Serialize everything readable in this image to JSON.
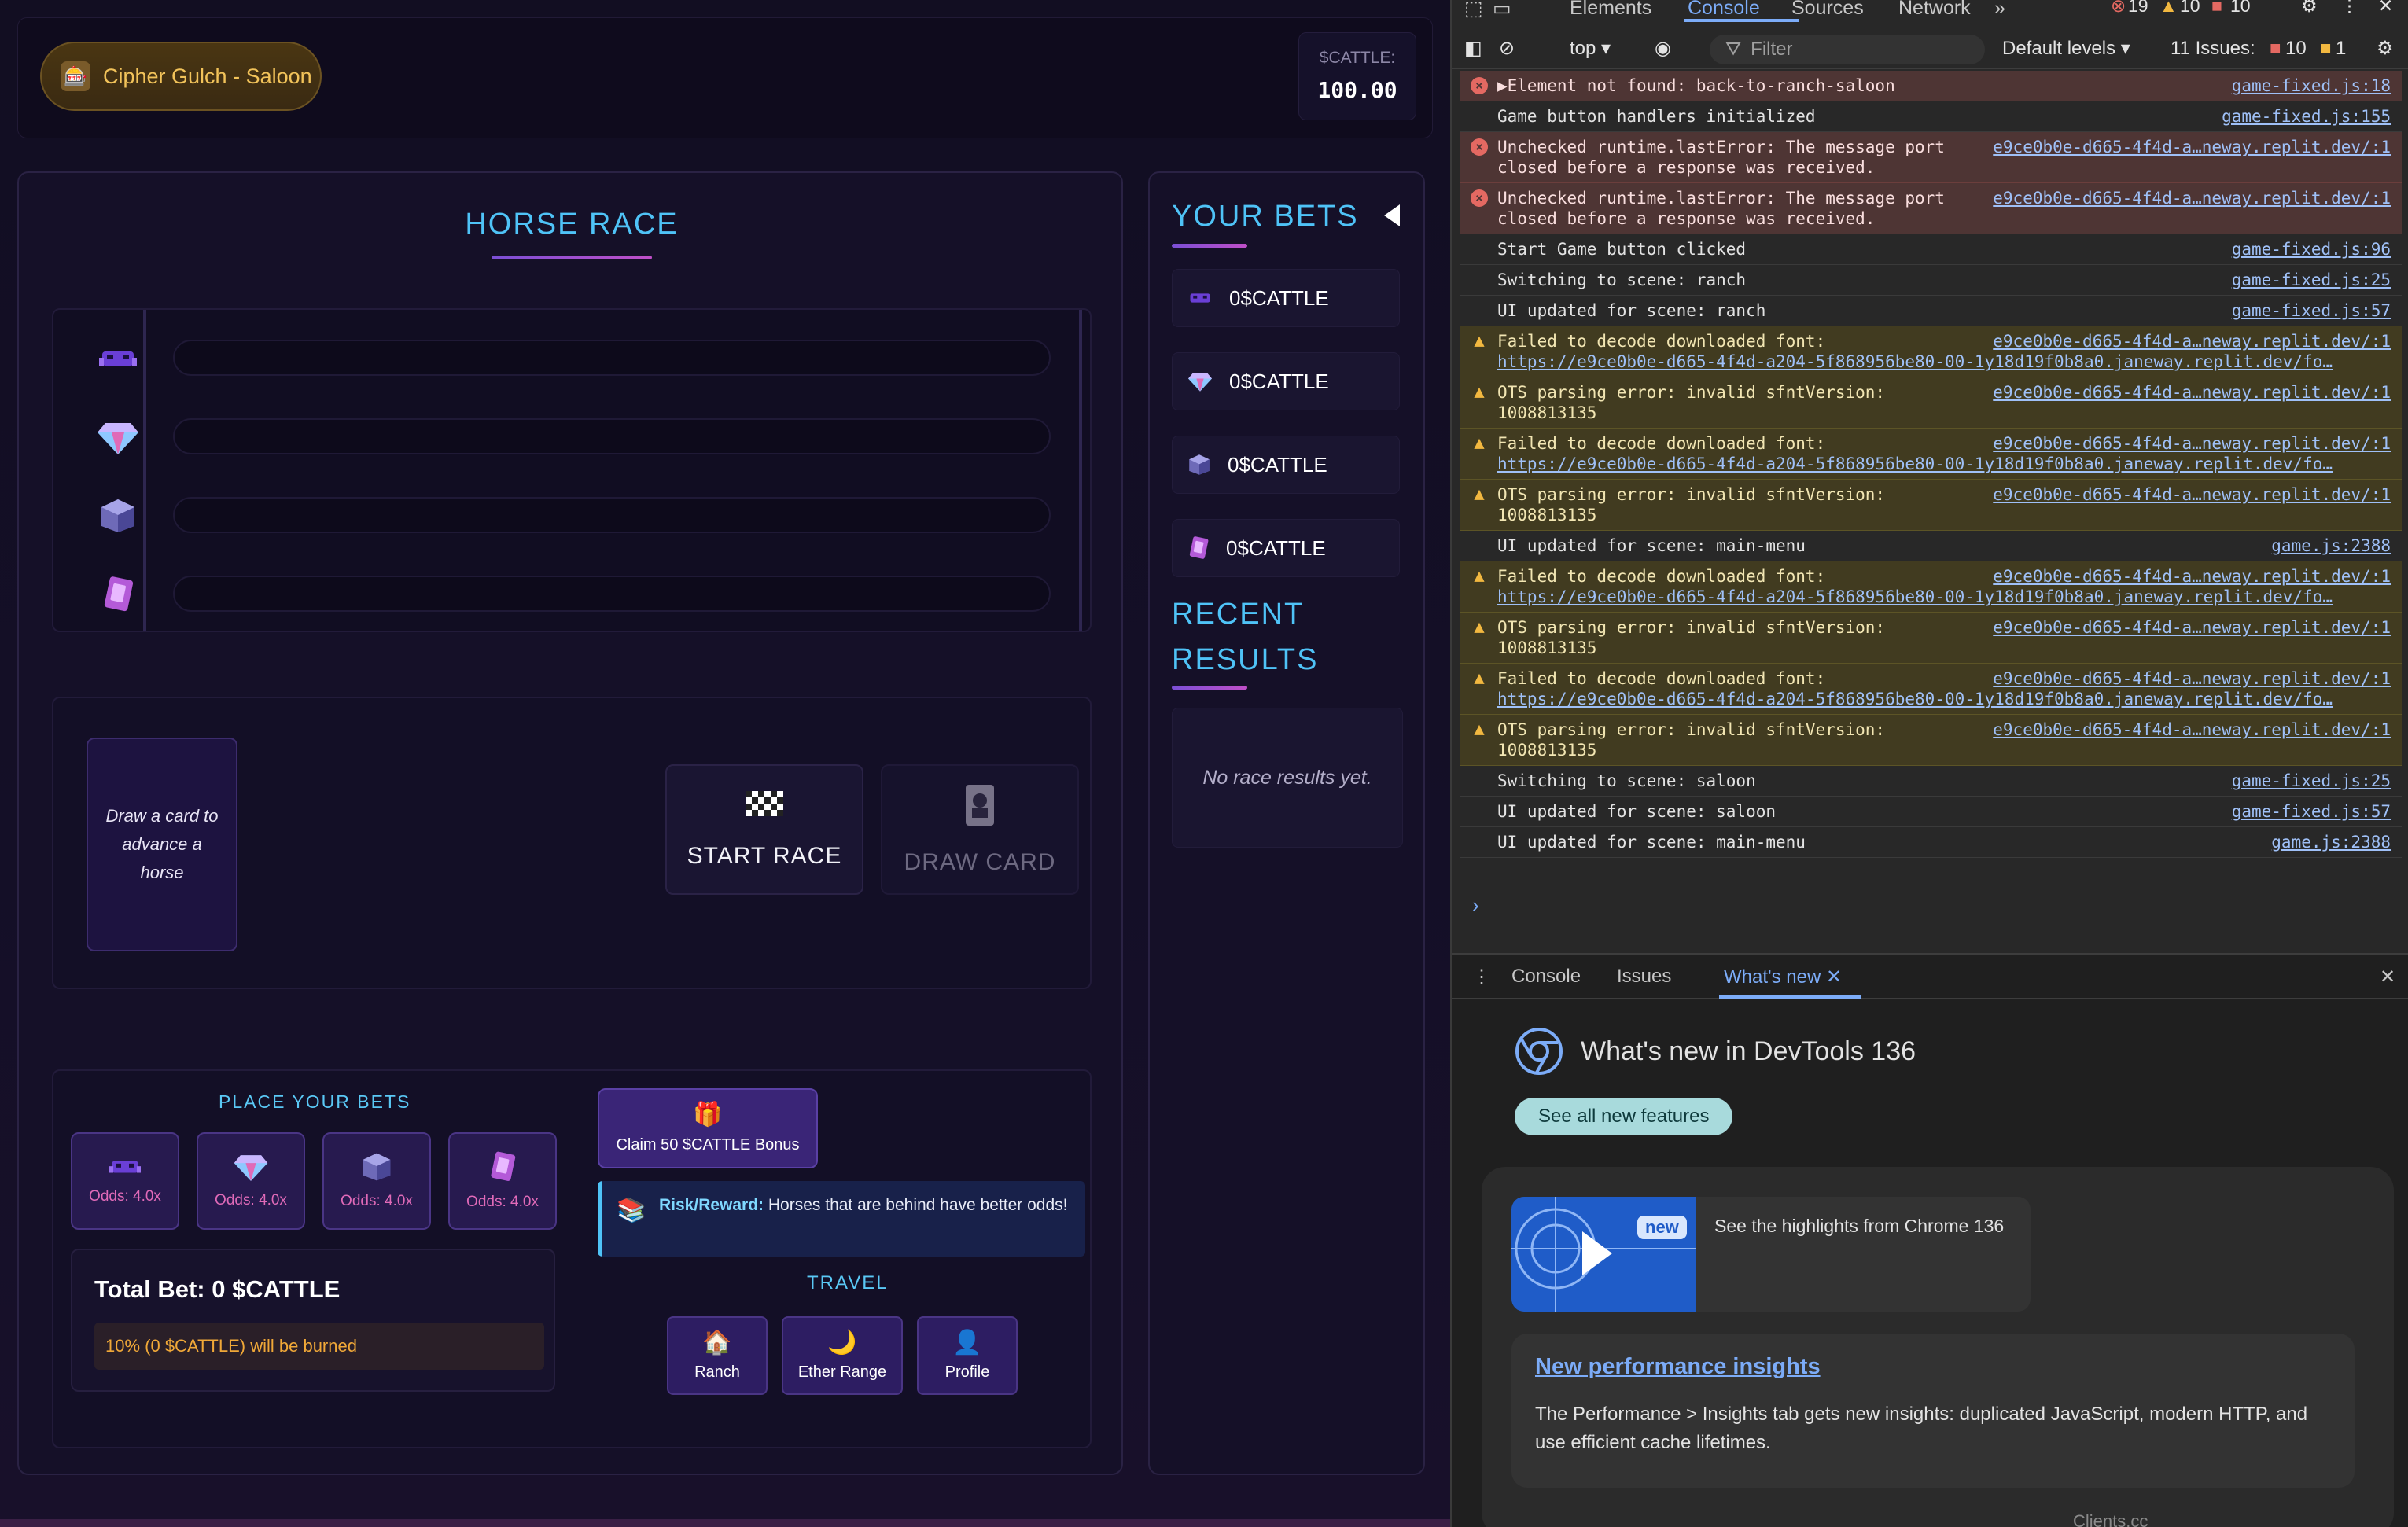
{
  "game": {
    "location": "Cipher Gulch - Saloon",
    "balance_label": "$CATTLE:",
    "balance_value": "100.00",
    "race_title": "HORSE RACE",
    "horses": [
      {
        "icon": "alien-monster-icon"
      },
      {
        "icon": "gem-icon"
      },
      {
        "icon": "cube-icon"
      },
      {
        "icon": "card-icon"
      }
    ],
    "card_prompt": "Draw a card to advance a horse",
    "start_label": "START RACE",
    "draw_label": "DRAW CARD",
    "bets_title": "PLACE YOUR BETS",
    "odds": [
      "Odds: 4.0x",
      "Odds: 4.0x",
      "Odds: 4.0x",
      "Odds: 4.0x"
    ],
    "total_bet": "Total Bet: 0 $CATTLE",
    "burn_notice": "10% (0 $CATTLE) will be burned",
    "bonus_label": "Claim 50 $CATTLE Bonus",
    "tip_strong": "Risk/Reward:",
    "tip_text": " Horses that are behind have better odds!",
    "travel_title": "TRAVEL",
    "travel": [
      "Ranch",
      "Ether Range",
      "Profile"
    ],
    "your_bets_title": "YOUR BETS",
    "bets": [
      "0$CATTLE",
      "0$CATTLE",
      "0$CATTLE",
      "0$CATTLE"
    ],
    "recent_title": "RECENT RESULTS",
    "no_results": "No race results yet."
  },
  "devtools": {
    "tabs": [
      "Elements",
      "Console",
      "Sources",
      "Network"
    ],
    "status_errors": "19",
    "status_warnings": "10",
    "status_issues_top": "10",
    "context": "top",
    "filter_placeholder": "Filter",
    "levels": "Default levels",
    "issues_label": "11 Issues:",
    "issues_errors": "10",
    "issues_warnings": "1",
    "logs": [
      {
        "level": "error",
        "msg": "▶Element not found: back-to-ranch-saloon",
        "src": "game-fixed.js:18"
      },
      {
        "level": "info",
        "msg": "Game button handlers initialized",
        "src": "game-fixed.js:155"
      },
      {
        "level": "error",
        "msg": "Unchecked runtime.lastError: The message port closed before a response was received.",
        "src": "e9ce0b0e-d665-4f4d-a…neway.replit.dev/:1"
      },
      {
        "level": "error",
        "msg": "Unchecked runtime.lastError: The message port closed before a response was received.",
        "src": "e9ce0b0e-d665-4f4d-a…neway.replit.dev/:1"
      },
      {
        "level": "info",
        "msg": "Start Game button clicked",
        "src": "game-fixed.js:96"
      },
      {
        "level": "info",
        "msg": "Switching to scene: ranch",
        "src": "game-fixed.js:25"
      },
      {
        "level": "info",
        "msg": "UI updated for scene: ranch",
        "src": "game-fixed.js:57"
      },
      {
        "level": "warn",
        "msg": "Failed to decode downloaded font:",
        "url": "https://e9ce0b0e-d665-4f4d-a204-5f868956be80-00-1y18d19f0b8a0.janeway.replit.dev/fo…",
        "src": "e9ce0b0e-d665-4f4d-a…neway.replit.dev/:1"
      },
      {
        "level": "warn",
        "msg": "OTS parsing error: invalid sfntVersion: 1008813135",
        "src": "e9ce0b0e-d665-4f4d-a…neway.replit.dev/:1"
      },
      {
        "level": "warn",
        "msg": "Failed to decode downloaded font:",
        "url": "https://e9ce0b0e-d665-4f4d-a204-5f868956be80-00-1y18d19f0b8a0.janeway.replit.dev/fo…",
        "src": "e9ce0b0e-d665-4f4d-a…neway.replit.dev/:1"
      },
      {
        "level": "warn",
        "msg": "OTS parsing error: invalid sfntVersion: 1008813135",
        "src": "e9ce0b0e-d665-4f4d-a…neway.replit.dev/:1"
      },
      {
        "level": "info",
        "msg": "UI updated for scene: main-menu",
        "src": "game.js:2388"
      },
      {
        "level": "warn",
        "msg": "Failed to decode downloaded font:",
        "url": "https://e9ce0b0e-d665-4f4d-a204-5f868956be80-00-1y18d19f0b8a0.janeway.replit.dev/fo…",
        "src": "e9ce0b0e-d665-4f4d-a…neway.replit.dev/:1"
      },
      {
        "level": "warn",
        "msg": "OTS parsing error: invalid sfntVersion: 1008813135",
        "src": "e9ce0b0e-d665-4f4d-a…neway.replit.dev/:1"
      },
      {
        "level": "warn",
        "msg": "Failed to decode downloaded font:",
        "url": "https://e9ce0b0e-d665-4f4d-a204-5f868956be80-00-1y18d19f0b8a0.janeway.replit.dev/fo…",
        "src": "e9ce0b0e-d665-4f4d-a…neway.replit.dev/:1"
      },
      {
        "level": "warn",
        "msg": "OTS parsing error: invalid sfntVersion: 1008813135",
        "src": "e9ce0b0e-d665-4f4d-a…neway.replit.dev/:1"
      },
      {
        "level": "info",
        "msg": "Switching to scene: saloon",
        "src": "game-fixed.js:25"
      },
      {
        "level": "info",
        "msg": "UI updated for scene: saloon",
        "src": "game-fixed.js:57"
      },
      {
        "level": "info",
        "msg": "UI updated for scene: main-menu",
        "src": "game.js:2388"
      }
    ],
    "drawer_tabs": [
      "Console",
      "Issues",
      "What's new"
    ],
    "whats_new_title": "What's new in DevTools 136",
    "see_all": "See all new features",
    "new_badge": "new",
    "highlight_text": "See the highlights from Chrome 136",
    "insight_title": "New performance insights",
    "insight_body": "The Performance > Insights tab gets new insights: duplicated JavaScript, modern HTTP, and use efficient cache lifetimes.",
    "footer_partial": "Clients.cc"
  }
}
